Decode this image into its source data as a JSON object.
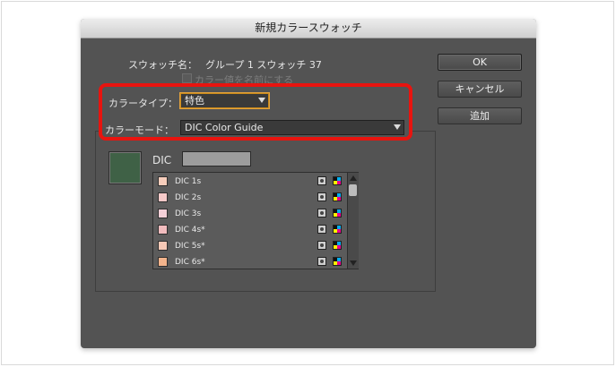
{
  "dialog": {
    "title": "新規カラースウォッチ",
    "swatch_name_label": "スウォッチ名：",
    "swatch_name_value": "グループ 1 スウォッチ 37",
    "name_by_value_label": "カラー値を名前にする",
    "color_type_label": "カラータイプ：",
    "color_type_value": "特色",
    "color_mode_label": "カラーモード：",
    "color_mode_value": "DIC Color Guide",
    "dic_label": "DIC",
    "buttons": {
      "ok": "OK",
      "cancel": "キャンセル",
      "add": "追加"
    }
  },
  "swatch_list": [
    {
      "name": "DIC 1s",
      "color": "#f6cdbb"
    },
    {
      "name": "DIC 2s",
      "color": "#f5c9c8"
    },
    {
      "name": "DIC 3s",
      "color": "#f3cfd7"
    },
    {
      "name": "DIC 4s*",
      "color": "#f1bcbe"
    },
    {
      "name": "DIC 5s*",
      "color": "#f6c8b6"
    },
    {
      "name": "DIC 6s*",
      "color": "#f3b48c"
    }
  ],
  "colors": {
    "highlight": "#e8140f",
    "preview": "#3f6146",
    "dialog_bg": "#535353"
  }
}
